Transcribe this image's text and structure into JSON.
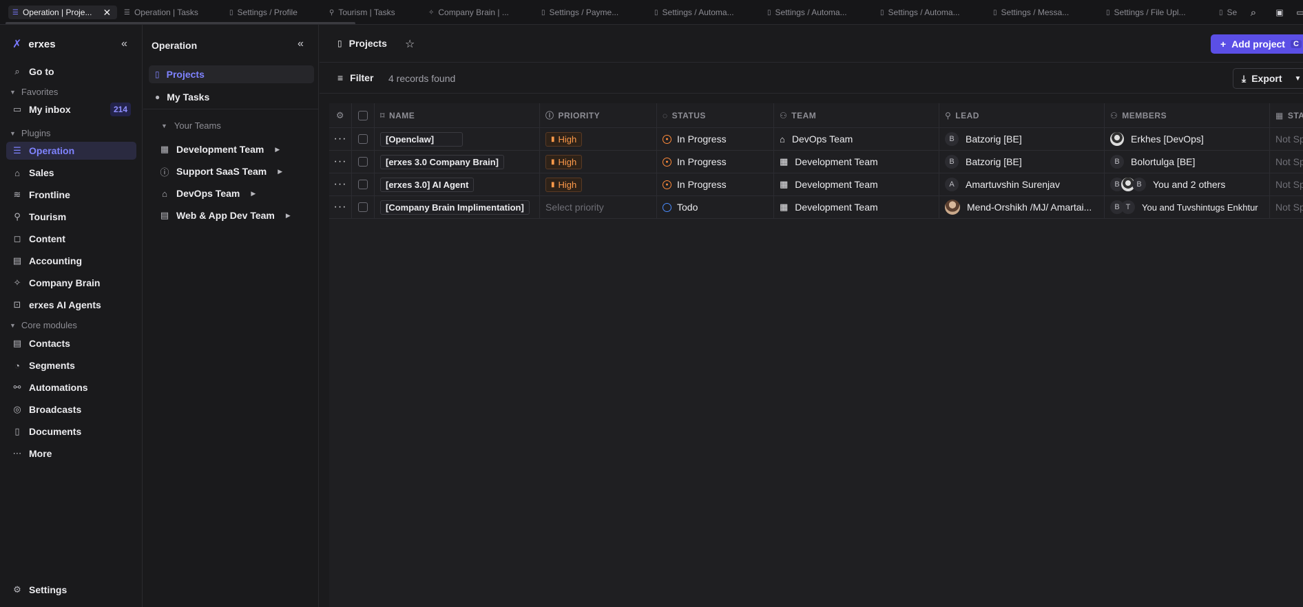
{
  "tabs": [
    {
      "label": "Operation | Proje...",
      "active": true,
      "icon": "list-icon"
    },
    {
      "label": "Operation | Tasks",
      "icon": "list-icon"
    },
    {
      "label": "Settings / Profile",
      "icon": "file-icon"
    },
    {
      "label": "Tourism | Tasks",
      "icon": "pin-icon"
    },
    {
      "label": "Company Brain | ...",
      "icon": "sparkle-icon"
    },
    {
      "label": "Settings / Payme...",
      "icon": "file-icon"
    },
    {
      "label": "Settings / Automa...",
      "icon": "file-icon"
    },
    {
      "label": "Settings / Automa...",
      "icon": "file-icon"
    },
    {
      "label": "Settings / Automa...",
      "icon": "file-icon"
    },
    {
      "label": "Settings / Messa...",
      "icon": "file-icon"
    },
    {
      "label": "Settings / File Upl...",
      "icon": "file-icon"
    },
    {
      "label": "Se",
      "icon": "file-icon"
    }
  ],
  "sidebar": {
    "brand": "erxes",
    "goto": "Go to",
    "favorites": "Favorites",
    "inbox": "My inbox",
    "inbox_count": "214",
    "plugins": "Plugins",
    "plugin_items": [
      "Operation",
      "Sales",
      "Frontline",
      "Tourism",
      "Content",
      "Accounting",
      "Company Brain",
      "erxes AI Agents"
    ],
    "core": "Core modules",
    "core_items": [
      "Contacts",
      "Segments",
      "Automations",
      "Broadcasts",
      "Documents",
      "More"
    ],
    "settings": "Settings"
  },
  "teams_panel": {
    "title": "Operation",
    "projects": "Projects",
    "my_tasks": "My Tasks",
    "your_teams": "Your Teams",
    "teams": [
      "Development Team",
      "Support SaaS Team",
      "DevOps Team",
      "Web & App Dev Team"
    ]
  },
  "header": {
    "title": "Projects",
    "add_project": "Add project",
    "add_shortcut": "C"
  },
  "toolbar": {
    "filter": "Filter",
    "records": "4 records found",
    "export": "Export"
  },
  "table": {
    "columns": [
      "NAME",
      "PRIORITY",
      "STATUS",
      "TEAM",
      "LEAD",
      "MEMBERS",
      "STA"
    ],
    "rows": [
      {
        "name": "[Openclaw]",
        "priority": "High",
        "status": "In Progress",
        "team": "DevOps Team",
        "lead_initial": "B",
        "lead": "Batzorig [BE]",
        "members": "Erkhes [DevOps]",
        "start": "Not Sp"
      },
      {
        "name": "[erxes 3.0 Company Brain]",
        "priority": "High",
        "status": "In Progress",
        "team": "Development Team",
        "lead_initial": "B",
        "lead": "Batzorig [BE]",
        "members_initial": "B",
        "members": "Bolortulga [BE]",
        "start": "Not Sp"
      },
      {
        "name": "[erxes 3.0] AI Agent",
        "priority": "High",
        "status": "In Progress",
        "team": "Development Team",
        "lead_initial": "A",
        "lead": "Amartuvshin Surenjav",
        "members_initials": [
          "B",
          "B"
        ],
        "members": "You and 2 others",
        "start": "Not Sp"
      },
      {
        "name": "[Company Brain Implimentation]",
        "priority": "Select priority",
        "status": "Todo",
        "team": "Development Team",
        "lead": "Mend-Orshikh /MJ/ Amartai...",
        "members_initials": [
          "B",
          "T"
        ],
        "members": "You and Tuvshintugs Enkhtur",
        "start": "Not Sp"
      }
    ]
  }
}
